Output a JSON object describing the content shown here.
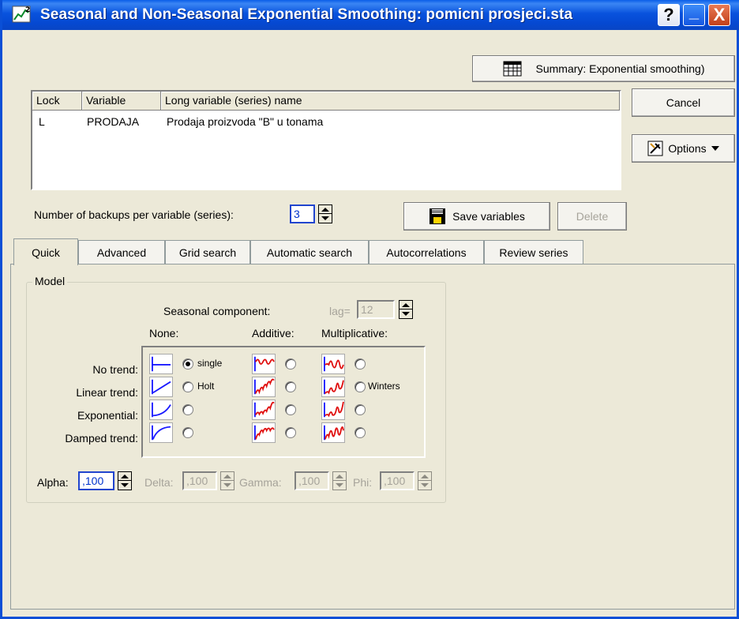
{
  "window": {
    "title": "Seasonal and Non-Seasonal Exponential Smoothing: pomicni prosjeci.sta",
    "help_label": "?",
    "minimize_label": "_",
    "close_label": "X"
  },
  "buttons": {
    "summary": "Summary:  Exponential smoothing)",
    "cancel": "Cancel",
    "options": "Options",
    "save_variables": "Save variables",
    "delete": "Delete"
  },
  "variable_list": {
    "columns": [
      "Lock",
      "Variable",
      "Long variable (series) name"
    ],
    "rows": [
      {
        "lock": "L",
        "variable": "PRODAJA",
        "long_name": "Prodaja proizvoda \"B\" u tonama"
      }
    ]
  },
  "backups": {
    "label": "Number of backups per variable (series):",
    "value": "3"
  },
  "tabs": [
    {
      "label": "Quick",
      "active": true
    },
    {
      "label": "Advanced"
    },
    {
      "label": "Grid search"
    },
    {
      "label": "Automatic search"
    },
    {
      "label": "Autocorrelations"
    },
    {
      "label": "Review series"
    }
  ],
  "model": {
    "group_label": "Model",
    "seasonal_label": "Seasonal component:",
    "lag_label": "lag=",
    "lag_value": "12",
    "col_headers": {
      "none": "None:",
      "additive": "Additive:",
      "multiplicative": "Multiplicative:"
    },
    "rows": [
      "No trend:",
      "Linear trend:",
      "Exponential:",
      "Damped trend:"
    ],
    "option_labels": {
      "single": "single",
      "holt": "Holt",
      "winters": "Winters"
    },
    "selected": "single"
  },
  "params": {
    "alpha_label": "Alpha:",
    "alpha_value": ",100",
    "delta_label": "Delta:",
    "delta_value": ",100",
    "gamma_label": "Gamma:",
    "gamma_value": ",100",
    "phi_label": "Phi:",
    "phi_value": ",100"
  },
  "colors": {
    "titlebar": "#0548d0",
    "dialog_bg": "#ece9d8",
    "icon_red": "#e01010",
    "icon_blue": "#1a1aff",
    "disabled_text": "#a6a39a"
  }
}
